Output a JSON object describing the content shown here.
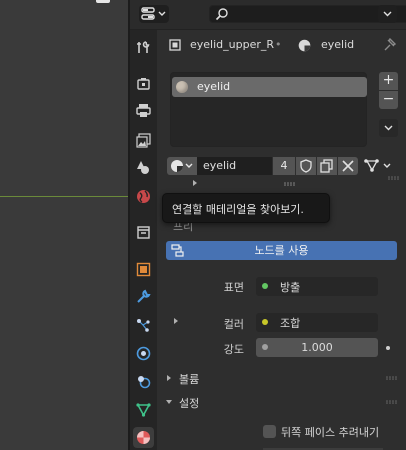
{
  "header": {
    "editor_type_icon": "properties-editor-icon",
    "search_icon": "search-icon",
    "search_value": "",
    "collapse_icon": "chevron-down-icon"
  },
  "tabs": [
    {
      "name": "tool",
      "icon": "wrench-screwdriver-icon",
      "active": false
    },
    {
      "name": "render",
      "icon": "camera-back-icon",
      "active": false
    },
    {
      "name": "output",
      "icon": "printer-icon",
      "active": false
    },
    {
      "name": "view-layer",
      "icon": "image-stack-icon",
      "active": false
    },
    {
      "name": "scene",
      "icon": "cone-sphere-icon",
      "active": false
    },
    {
      "name": "world",
      "icon": "globe-icon",
      "active": false
    },
    {
      "name": "collection",
      "icon": "box-icon",
      "active": false
    },
    {
      "name": "object",
      "icon": "object-square-icon",
      "active": false
    },
    {
      "name": "modifiers",
      "icon": "wrench-icon",
      "active": false
    },
    {
      "name": "particles",
      "icon": "particles-icon",
      "active": false
    },
    {
      "name": "physics",
      "icon": "orbit-icon",
      "active": false
    },
    {
      "name": "constraints",
      "icon": "constraint-icon",
      "active": false
    },
    {
      "name": "data",
      "icon": "mesh-triangle-icon",
      "active": false
    },
    {
      "name": "material",
      "icon": "material-sphere-icon",
      "active": true
    }
  ],
  "breadcrumb": {
    "object_name": "eyelid_upper_R",
    "material_name": "eyelid"
  },
  "slots": {
    "items": [
      {
        "label": "eyelid"
      }
    ],
    "add_label": "+",
    "remove_label": "−"
  },
  "material": {
    "name": "eyelid",
    "users": "4"
  },
  "tooltip": "연결할 매테리얼을 찾아보기.",
  "preview_partial": "프리",
  "surface": {
    "use_nodes_label": "노드를 사용",
    "surface_label": "표면",
    "surface_value": "방출",
    "color_label": "컬러",
    "color_value": "조합",
    "strength_label": "강도",
    "strength_value": "1.000"
  },
  "panels": {
    "volume_label": "볼륨",
    "settings_label": "설정",
    "backface_label": "뒤쪽 페이스 추려내기"
  },
  "colors": {
    "accent": "#4772b3",
    "emission_socket": "#63c763",
    "color_socket": "#c7c729",
    "material_tab": "#e05a5a"
  }
}
